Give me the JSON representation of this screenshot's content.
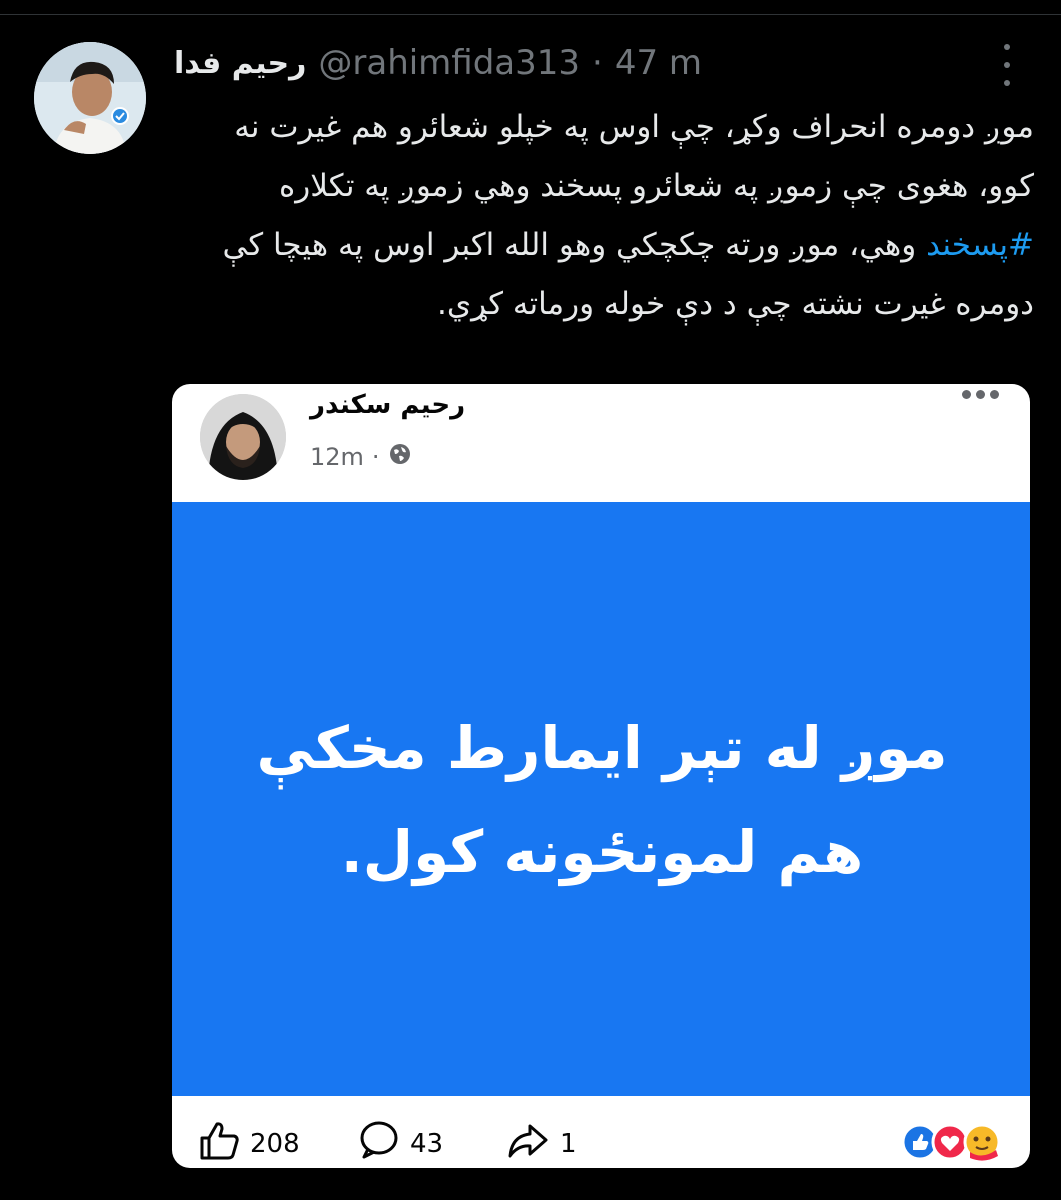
{
  "tweet": {
    "display_name": "رحیم فدا",
    "handle": "@rahimfida313",
    "dot": "·",
    "time": "47 m",
    "text_before_hashtag": "موږ دومره انحراف وکړ، چې اوس په خپلو شعائرو هم غیرت نه کوو، هغوی چې زموږ په شعائرو پسخند وهي زموږ په تکلاره ",
    "hashtag": "#پسخند",
    "text_after_hashtag": " وهي، موږ ورته چکچکي وهو الله اکبر اوس په هیچا کې دومره غیرت نشته چې د دې خوله ورماته کړي."
  },
  "fb_post": {
    "author": "رحیم سکندر",
    "time": "12m",
    "dot": "·",
    "icon": "globe-icon",
    "body": "موږ له تېر ایمارط مخکې هم لمونځونه کول.",
    "likes": "208",
    "comments": "43",
    "shares": "1",
    "panel_color": "#1877f2"
  },
  "colors": {
    "background": "#000000",
    "text": "#e7e9ea",
    "muted": "#71767b",
    "link": "#1d9bf0"
  }
}
